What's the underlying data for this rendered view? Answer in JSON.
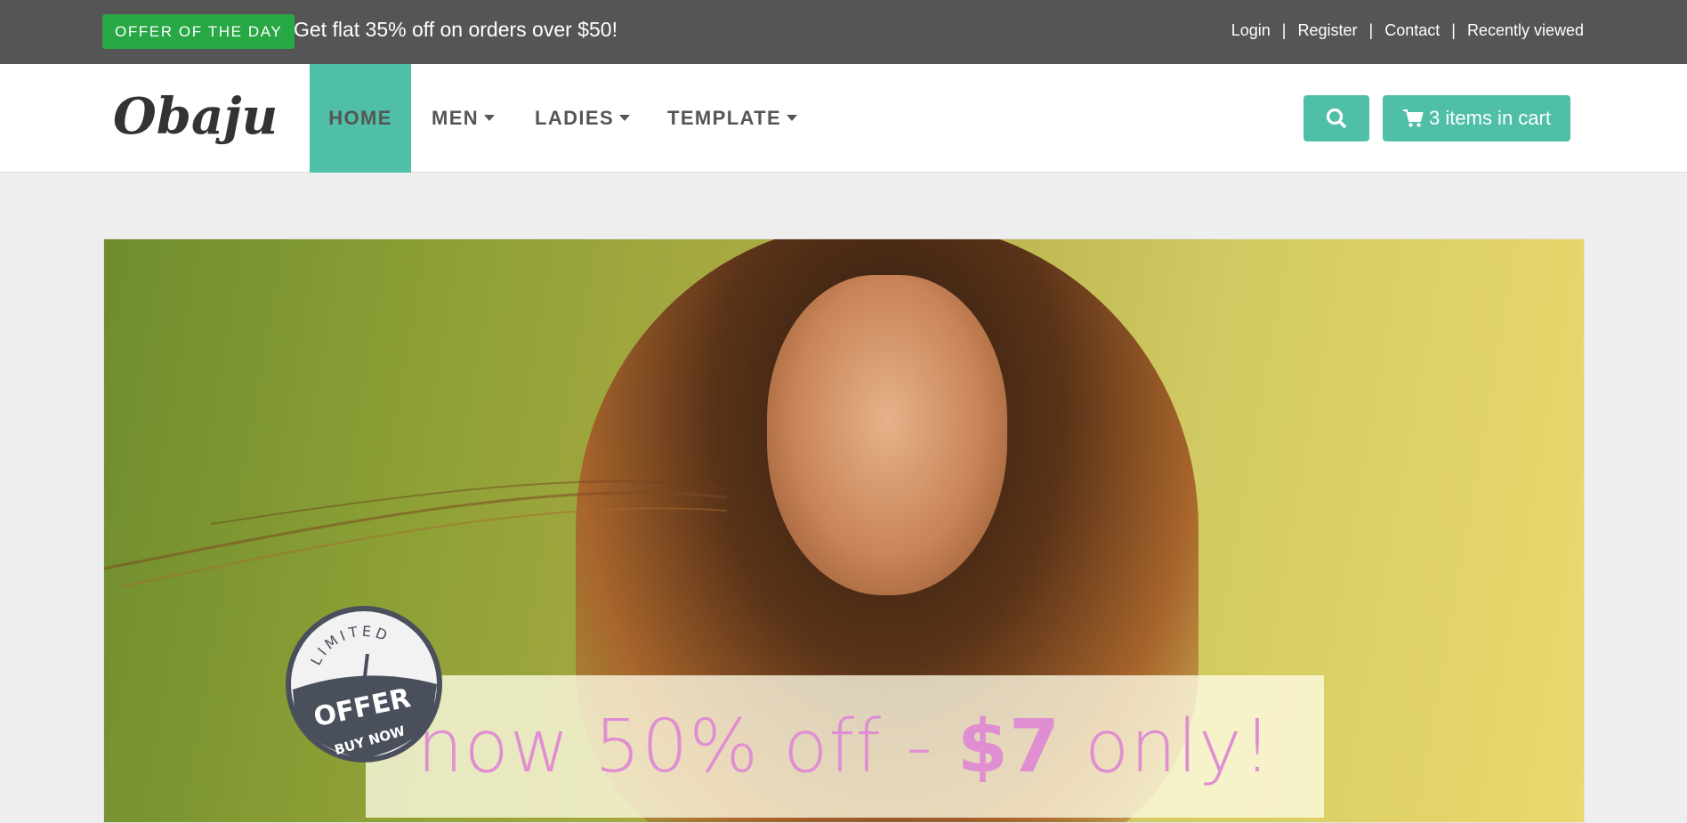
{
  "topbar": {
    "offer_badge": "OFFER OF THE DAY",
    "offer_text": "Get flat 35% off on orders over $50!",
    "links": [
      "Login",
      "Register",
      "Contact",
      "Recently viewed"
    ],
    "separator": "|"
  },
  "navbar": {
    "logo_text": "Obaju",
    "items": [
      {
        "label": "HOME",
        "active": true
      },
      {
        "label": "MEN",
        "dropdown": true
      },
      {
        "label": "LADIES",
        "dropdown": true
      },
      {
        "label": "TEMPLATE",
        "dropdown": true
      }
    ],
    "search_icon": "search-icon",
    "cart_label": "3 items in cart",
    "cart_icon": "cart-icon"
  },
  "hero": {
    "price_prefix": "now 50% off - ",
    "price_value": "$7",
    "price_suffix": " only!",
    "badge": {
      "top": "LIMITED",
      "middle": "OFFER",
      "bottom": "BUY NOW"
    }
  },
  "colors": {
    "topbar_bg": "#555555",
    "offer_green": "#28a745",
    "accent": "#4fbfa8",
    "price_pink": "#e08ed2",
    "page_bg": "#eeeeee"
  }
}
